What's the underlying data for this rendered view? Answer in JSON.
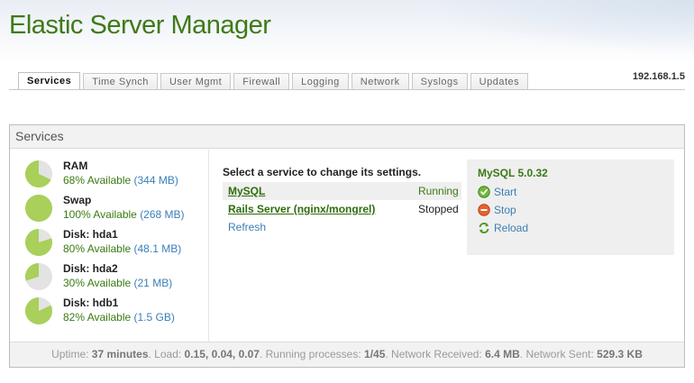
{
  "app": {
    "title": "Elastic Server Manager"
  },
  "tabs": [
    {
      "label": "Services",
      "active": true
    },
    {
      "label": "Time Synch",
      "active": false
    },
    {
      "label": "User Mgmt",
      "active": false
    },
    {
      "label": "Firewall",
      "active": false
    },
    {
      "label": "Logging",
      "active": false
    },
    {
      "label": "Network",
      "active": false
    },
    {
      "label": "Syslogs",
      "active": false
    },
    {
      "label": "Updates",
      "active": false
    }
  ],
  "ip_address": "192.168.1.5",
  "panel": {
    "title": "Services"
  },
  "resources": [
    {
      "name": "RAM",
      "available": "68% Available",
      "size": "(344 MB)",
      "fraction": 0.68
    },
    {
      "name": "Swap",
      "available": "100% Available",
      "size": "(268 MB)",
      "fraction": 1.0
    },
    {
      "name": "Disk: hda1",
      "available": "80% Available",
      "size": "(48.1 MB)",
      "fraction": 0.8
    },
    {
      "name": "Disk: hda2",
      "available": "30% Available",
      "size": "(21 MB)",
      "fraction": 0.3
    },
    {
      "name": "Disk: hdb1",
      "available": "82% Available",
      "size": "(1.5 GB)",
      "fraction": 0.82
    }
  ],
  "services": {
    "prompt": "Select a service to change its settings.",
    "list": [
      {
        "name": "MySQL",
        "status": "Running"
      },
      {
        "name": "Rails Server (nginx/mongrel)",
        "status": "Stopped"
      }
    ],
    "refresh_label": "Refresh"
  },
  "selected_service": {
    "title": "MySQL 5.0.32",
    "actions": [
      {
        "label": "Start",
        "icon": "start-icon"
      },
      {
        "label": "Stop",
        "icon": "stop-icon"
      },
      {
        "label": "Reload",
        "icon": "reload-icon"
      }
    ]
  },
  "footer": {
    "uptime_label": "Uptime:",
    "uptime": "37 minutes",
    "load_label": ". Load:",
    "load": "0.15, 0.04, 0.07",
    "processes_label": ". Running processes:",
    "processes": "1/45",
    "received_label": ". Network Received:",
    "received": "6.4 MB",
    "sent_label": ". Network Sent:",
    "sent": "529.3 KB"
  },
  "colors": {
    "pie_fill": "#a8d05a",
    "pie_empty": "#e3e3e3",
    "title_green": "#3f7a17",
    "link_blue": "#3a7fb8"
  }
}
